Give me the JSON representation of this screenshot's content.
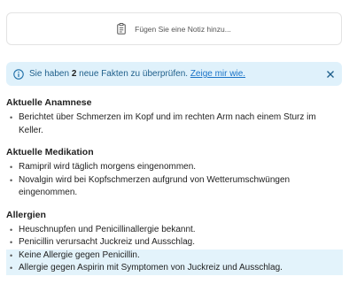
{
  "note": {
    "placeholder": "Fügen Sie eine Notiz hinzu..."
  },
  "banner": {
    "prefix": "Sie haben ",
    "count": "2",
    "suffix": " neue Fakten zu überprüfen. ",
    "link": "Zeige mir wie.",
    "accent": "#dff1fb"
  },
  "sections": [
    {
      "title": "Aktuelle Anamnese",
      "items": [
        {
          "text": "Berichtet über Schmerzen im Kopf und im rechten Arm nach einem Sturz im Keller.",
          "highlight": false
        }
      ]
    },
    {
      "title": "Aktuelle Medikation",
      "items": [
        {
          "text": "Ramipril wird täglich morgens eingenommen.",
          "highlight": false
        },
        {
          "text": "Novalgin wird bei Kopfschmerzen aufgrund von Wetterumschwüngen eingenommen.",
          "highlight": false
        }
      ]
    },
    {
      "title": "Allergien",
      "items": [
        {
          "text": "Heuschnupfen und Penicillinallergie bekannt.",
          "highlight": false
        },
        {
          "text": "Penicillin verursacht Juckreiz und Ausschlag.",
          "highlight": false
        },
        {
          "text": "Keine Allergie gegen Penicillin.",
          "highlight": true
        },
        {
          "text": "Allergie gegen Aspirin mit Symptomen von Juckreiz und Ausschlag.",
          "highlight": true
        }
      ]
    }
  ]
}
